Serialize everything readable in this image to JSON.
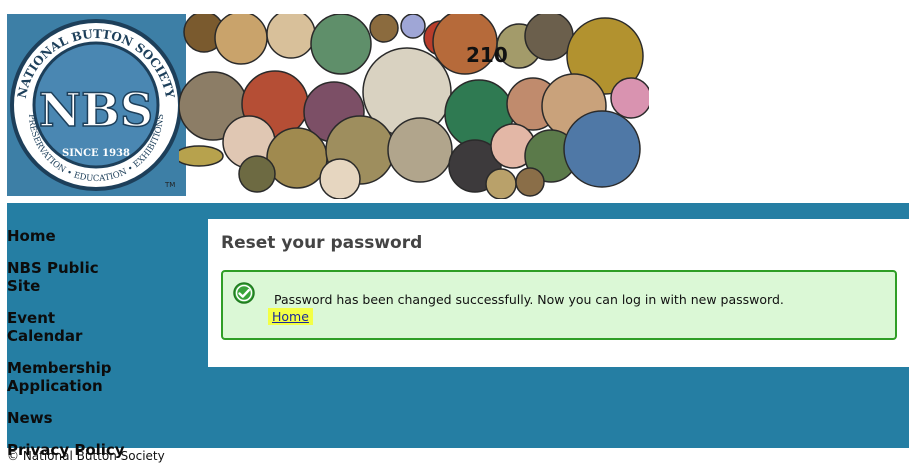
{
  "header": {
    "logo_alt": "NBS — National Button Society, Preservation • Education • Exhibitions, Since 1938",
    "logo_main": "NBS",
    "logo_ring_top": "NATIONAL BUTTON SOCIETY",
    "logo_since": "SINCE 1938",
    "logo_ring_bottom": "PRESERVATION • EDUCATION • EXHIBITIONS",
    "tm": "TM",
    "banner_number": "210",
    "brand_color": "#3d7fa6"
  },
  "sidebar": {
    "items": [
      {
        "label": "Home"
      },
      {
        "label": "NBS Public Site"
      },
      {
        "label": "Event Calendar"
      },
      {
        "label": "Membership Application"
      },
      {
        "label": "News"
      },
      {
        "label": "Privacy Policy"
      }
    ]
  },
  "main": {
    "title": "Reset your password",
    "message": "Password has been changed successfully. Now you can log in with new password.",
    "link_label": "Home",
    "success_icon": "check-circle-icon"
  },
  "footer": {
    "text": "© National Button Society"
  },
  "colors": {
    "band": "#257ea3",
    "success_bg": "#dbf8d6",
    "success_border": "#2f9e26",
    "link_highlight": "#f3ff45"
  }
}
